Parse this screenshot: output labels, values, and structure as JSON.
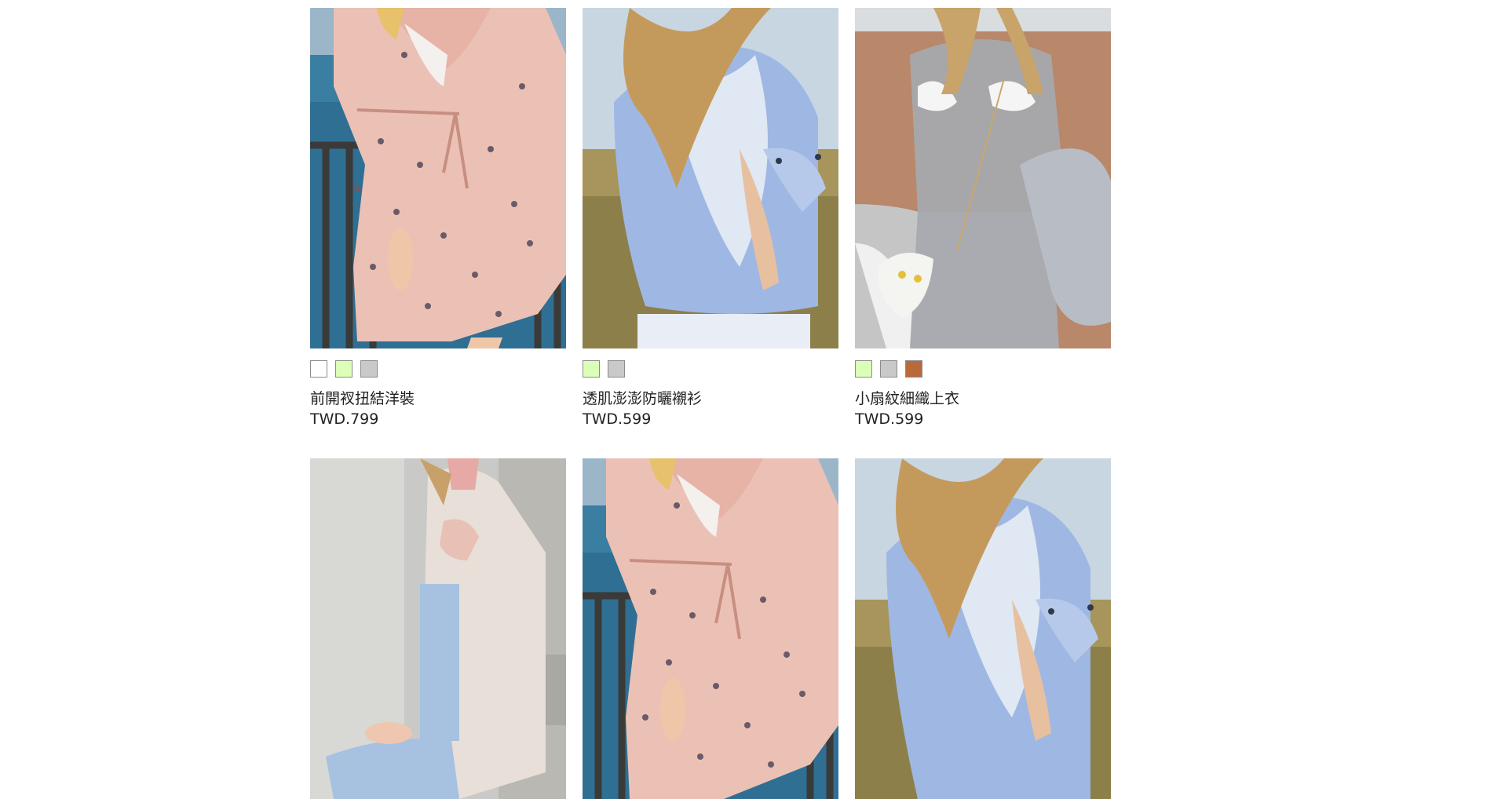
{
  "colors": {
    "white": "#ffffff",
    "lime": "#dcffb8",
    "gray": "#c9c9cb",
    "brown": "#b86b3a"
  },
  "products": [
    {
      "name": "前開衩扭結洋裝",
      "price": "TWD.799",
      "image": "pink-floral-dress-seaside",
      "swatches": [
        "#ffffff",
        "#dcffb8",
        "#c9c9cb"
      ]
    },
    {
      "name": "透肌澎澎防曬襯衫",
      "price": "TWD.599",
      "image": "blue-white-shirt-wind",
      "swatches": [
        "#dcffb8",
        "#c9c9cb"
      ]
    },
    {
      "name": "小扇紋細織上衣",
      "price": "TWD.599",
      "image": "gray-blouse-shell-pockets",
      "swatches": [
        "#dcffb8",
        "#c9c9cb",
        "#b86b3a"
      ]
    },
    {
      "image": "beige-cardigan-jeans"
    },
    {
      "image": "pink-floral-dress-seaside"
    },
    {
      "image": "blue-white-shirt-wind"
    }
  ]
}
